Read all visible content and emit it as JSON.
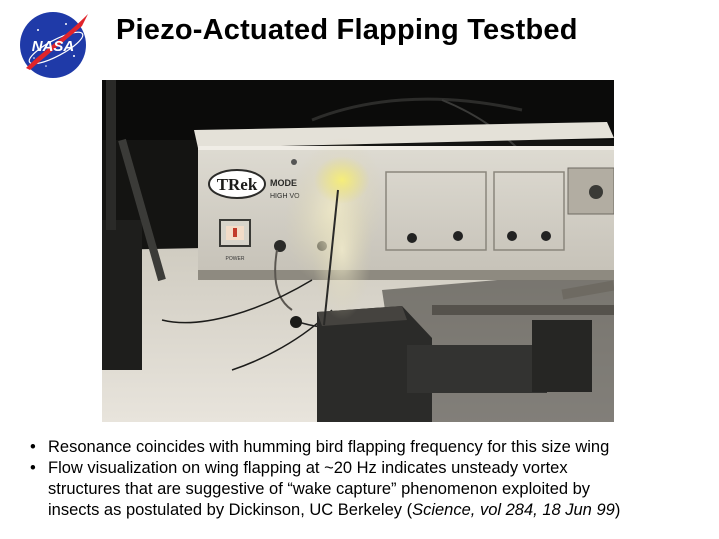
{
  "slide": {
    "title": "Piezo-Actuated Flapping Testbed",
    "logo": {
      "text": "NASA",
      "icon": "nasa-meatball-icon",
      "colors": {
        "circle": "#1f3aa8",
        "swoosh": "#e0242b",
        "text": "#ffffff"
      }
    },
    "photo": {
      "icon": "photo-testbed-image",
      "panel_labels": {
        "brand": "TRek",
        "model": "MODE",
        "subtitle": "HIGH VO",
        "power": "POWER"
      }
    },
    "bullets": [
      {
        "marker": "•",
        "text": "Resonance coincides with humming bird flapping frequency for this size wing"
      },
      {
        "marker": "•",
        "line1": "Flow visualization on wing flapping at ~20 Hz indicates unsteady vortex",
        "line2": "structures that are suggestive of “wake capture” phenomenon exploited by",
        "line3_plain": "insects as postulated by Dickinson, UC Berkeley (",
        "line3_italic": "Science, vol 284, 18 Jun 99",
        "line3_close": ")"
      }
    ]
  }
}
